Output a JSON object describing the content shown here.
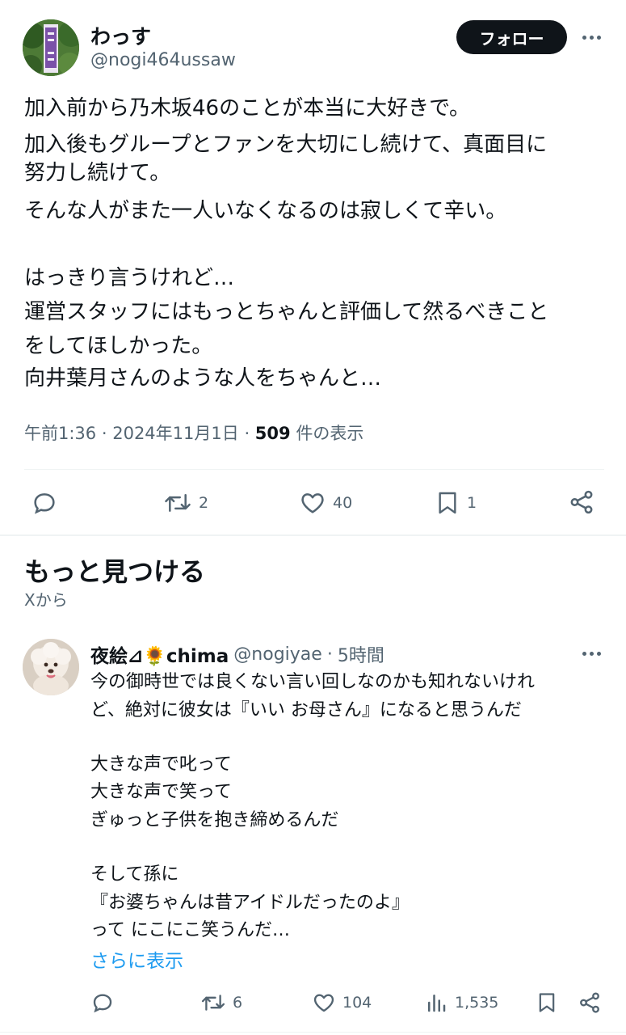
{
  "main_tweet": {
    "author": {
      "display_name": "わっす",
      "handle": "@nogi464ussaw"
    },
    "follow_label": "フォロー",
    "text_lines": [
      "加入前から乃木坂46のことが本当に大好きで。",
      "加入後もグループとファンを大切にし続けて、真面目に",
      "努力し続けて。",
      "そんな人がまた一人いなくなるのは寂しくて辛い。",
      "",
      "はっきり言うけれど…",
      "運営スタッフにはもっとちゃんと評価して然るべきこと",
      "をしてほしかった。",
      "向井葉月さんのような人をちゃんと…"
    ],
    "time": "午前1:36",
    "date": "2024年11月1日",
    "views_count": "509",
    "views_label": "件の表示",
    "stats": {
      "retweets": "2",
      "likes": "40",
      "bookmarks": "1"
    }
  },
  "discover": {
    "title": "もっと見つける",
    "subtitle": "Xから"
  },
  "second_tweet": {
    "author": {
      "display_name": "夜絵⊿🌻chima",
      "handle": "@nogiyae",
      "time_ago": "5時間"
    },
    "text_lines": [
      "今の御時世では良くない言い回しなのかも知れないけれ",
      "ど、絶対に彼女は『いい お母さん』になると思うんだ",
      "",
      "大きな声で叱って",
      "大きな声で笑って",
      "ぎゅっと子供を抱き締めるんだ",
      "",
      "そして孫に",
      "『お婆ちゃんは昔アイドルだったのよ』",
      "って にこにこ笑うんだ…"
    ],
    "show_more": "さらに表示",
    "stats": {
      "retweets": "6",
      "likes": "104",
      "views": "1,535"
    }
  },
  "colors": {
    "text": "#0f1419",
    "secondary": "#536471",
    "link": "#1d9bf0",
    "divider": "#eff3f4"
  }
}
